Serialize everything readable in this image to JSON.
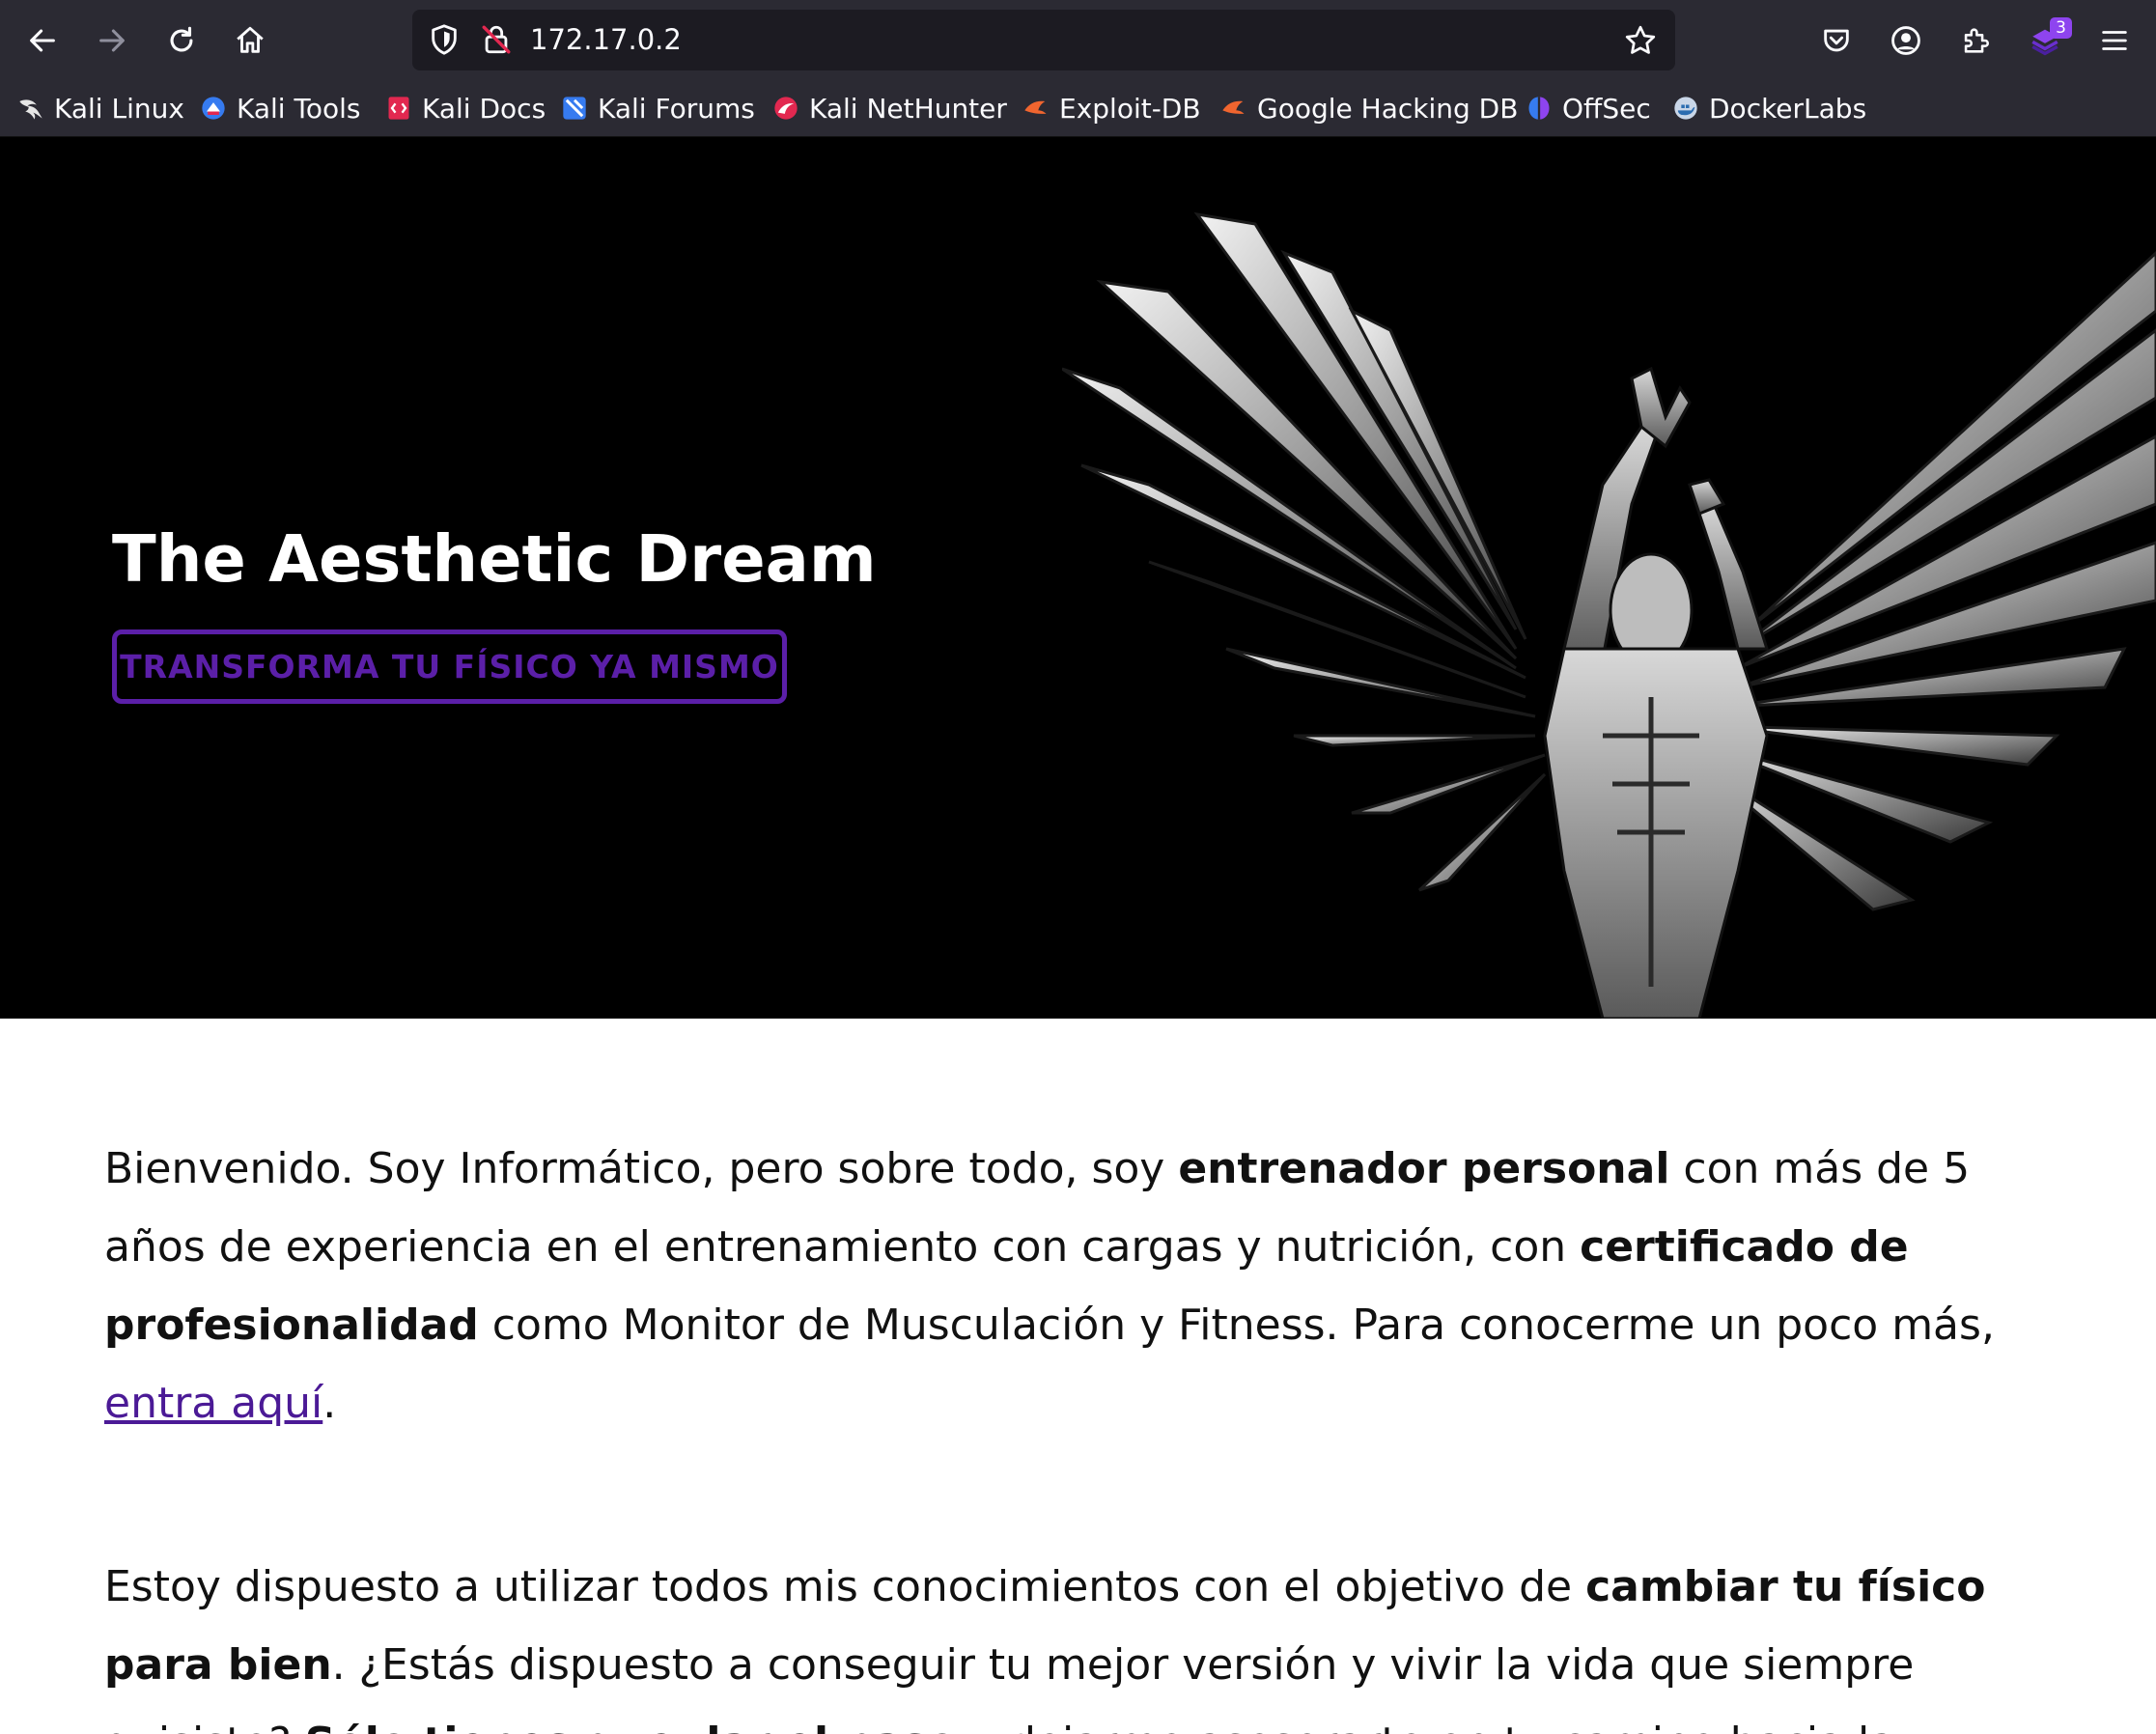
{
  "browser": {
    "url": "172.17.0.2",
    "extensions_badge": "3"
  },
  "bookmarks": [
    {
      "label": "Kali Linux",
      "icon": "kali-dragon-icon"
    },
    {
      "label": "Kali Tools",
      "icon": "kali-tools-icon"
    },
    {
      "label": "Kali Docs",
      "icon": "kali-docs-icon"
    },
    {
      "label": "Kali Forums",
      "icon": "kali-forums-icon"
    },
    {
      "label": "Kali NetHunter",
      "icon": "nethunter-icon"
    },
    {
      "label": "Exploit-DB",
      "icon": "exploit-db-icon"
    },
    {
      "label": "Google Hacking DB",
      "icon": "ghdb-icon"
    },
    {
      "label": "OffSec",
      "icon": "offsec-icon"
    },
    {
      "label": "DockerLabs",
      "icon": "dockerlabs-icon"
    }
  ],
  "hero": {
    "title": "The Aesthetic Dream",
    "button_label": "TRANSFORMA TU FÍSICO YA MISMO",
    "image": "winged-bodybuilder-illustration"
  },
  "intro": {
    "p1_a": "Bienvenido. Soy Informático, pero sobre todo, soy ",
    "p1_b": "entrenador personal",
    "p1_c": " con más de 5 años de experiencia en el entrenamiento con cargas y nutrición, con ",
    "p1_d": "certificado de profesionalidad",
    "p1_e": " como Monitor de Musculación y Fitness. Para conocerme un poco más, ",
    "p1_link": "entra aquí",
    "p1_end": ".",
    "p2_a": "Estoy dispuesto a utilizar todos mis conocimientos con el objetivo de ",
    "p2_b": "cambiar tu físico para bien",
    "p2_c": ". ¿Estás dispuesto a conseguir tu mejor versión y vivir la vida que siempre quisiste? ",
    "p2_d": "Sólo tienes que dar el paso",
    "p2_e": " y dejarme asesorarte en tu camino hacia la"
  },
  "colors": {
    "chrome_bg": "#2b2a33",
    "urlbar_bg": "#1c1b22",
    "accent_purple": "#5b1fa8",
    "link_purple": "#4b1a96"
  }
}
